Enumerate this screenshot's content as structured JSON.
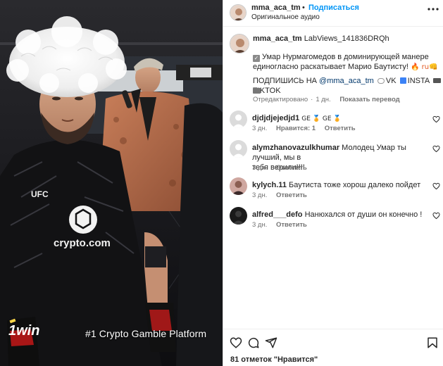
{
  "media": {
    "overlay_brand": "1win",
    "overlay_text": "#1 Crypto Gamble Platform",
    "shirt_brand": "crypto.com",
    "shirt_logo": "UFC"
  },
  "header": {
    "username": "mma_aca_tm",
    "separator": "•",
    "follow_label": "Подписаться",
    "audio_label": "Оригинальное аудио",
    "more_icon": "more-horizontal-icon"
  },
  "caption": {
    "username": "mma_aca_tm",
    "title": "LabViews_141836DRQh",
    "line1": "Умар Нурмагомедов в доминирующей манере",
    "line2": "единогласно раскатывает Марио Баутисту!",
    "line2_emoji": "🔥 ru👊",
    "sub_prefix": "ПОДПИШИСЬ НА ",
    "sub_handle": "@mma_aca_tm",
    "sub_vk": "VK",
    "sub_insta": "INSTA",
    "sub_tiktok": "TIKTOK",
    "edited": "Отредактировано",
    "dot": "·",
    "time": "1 дн.",
    "translate": "Показать перевод"
  },
  "comments": [
    {
      "username": "djdjdjejedjd1",
      "text": "GE 🏅 GE 🏅",
      "time": "3 дн.",
      "likes": "Нравится: 1",
      "reply": "Ответить"
    },
    {
      "username": "alymzhanovazulkhumar",
      "text": "Молодец Умар ты лучший, мы в",
      "text2": "тебя верили!!!!",
      "time": "3 дн.",
      "reply": "Ответить"
    },
    {
      "username": "kylych.11",
      "text": "Баутиста тоже хорош далеко пойдет",
      "time": "3 дн.",
      "reply": "Ответить"
    },
    {
      "username": "alfred___defo",
      "text": "Нанюхался от души он конечно !",
      "time": "3 дн.",
      "reply": "Ответить"
    }
  ],
  "footer": {
    "likes_count": "81 отметок \"Нравится\"",
    "icons": [
      "heart-icon",
      "comment-icon",
      "share-icon",
      "bookmark-icon"
    ]
  },
  "colors": {
    "accent": "#0095f6",
    "link": "#00376b",
    "muted": "#737373",
    "text": "#262626"
  }
}
